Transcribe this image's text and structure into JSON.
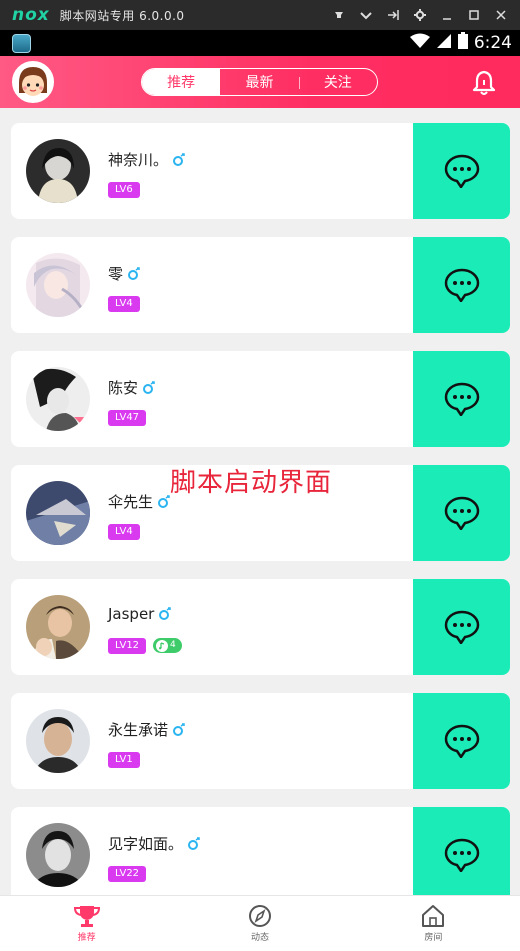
{
  "emulator": {
    "logo": "nox",
    "title": "脚本网站专用 6.0.0.0",
    "controls": [
      "pin-icon",
      "chevron-down-icon",
      "expand-icon",
      "gear-icon",
      "minimize-icon",
      "maximize-icon",
      "close-icon"
    ]
  },
  "status_bar": {
    "time": "6:24"
  },
  "header": {
    "tabs": [
      {
        "label": "推荐",
        "active": true
      },
      {
        "label": "最新",
        "active": false
      },
      {
        "label": "关注",
        "active": false
      }
    ]
  },
  "users": [
    {
      "name": "神奈川。",
      "level": "LV6"
    },
    {
      "name": "零",
      "level": "LV4"
    },
    {
      "name": "陈安",
      "level": "LV47"
    },
    {
      "name": "伞先生",
      "level": "LV4"
    },
    {
      "name": "Jasper",
      "level": "LV12",
      "extra_badge": "4"
    },
    {
      "name": "永生承诺",
      "level": "LV1"
    },
    {
      "name": "见字如面。",
      "level": "LV22"
    }
  ],
  "overlay_text": "脚本启动界面",
  "bottom_nav": [
    {
      "label": "推荐",
      "icon": "trophy-icon",
      "active": true
    },
    {
      "label": "动态",
      "icon": "compass-icon",
      "active": false
    },
    {
      "label": "房间",
      "icon": "house-icon",
      "active": false
    }
  ],
  "colors": {
    "accent": "#ff3a6a",
    "chat": "#1bebb7",
    "level_badge": "#d93af0",
    "gender": "#2ab4f0"
  }
}
